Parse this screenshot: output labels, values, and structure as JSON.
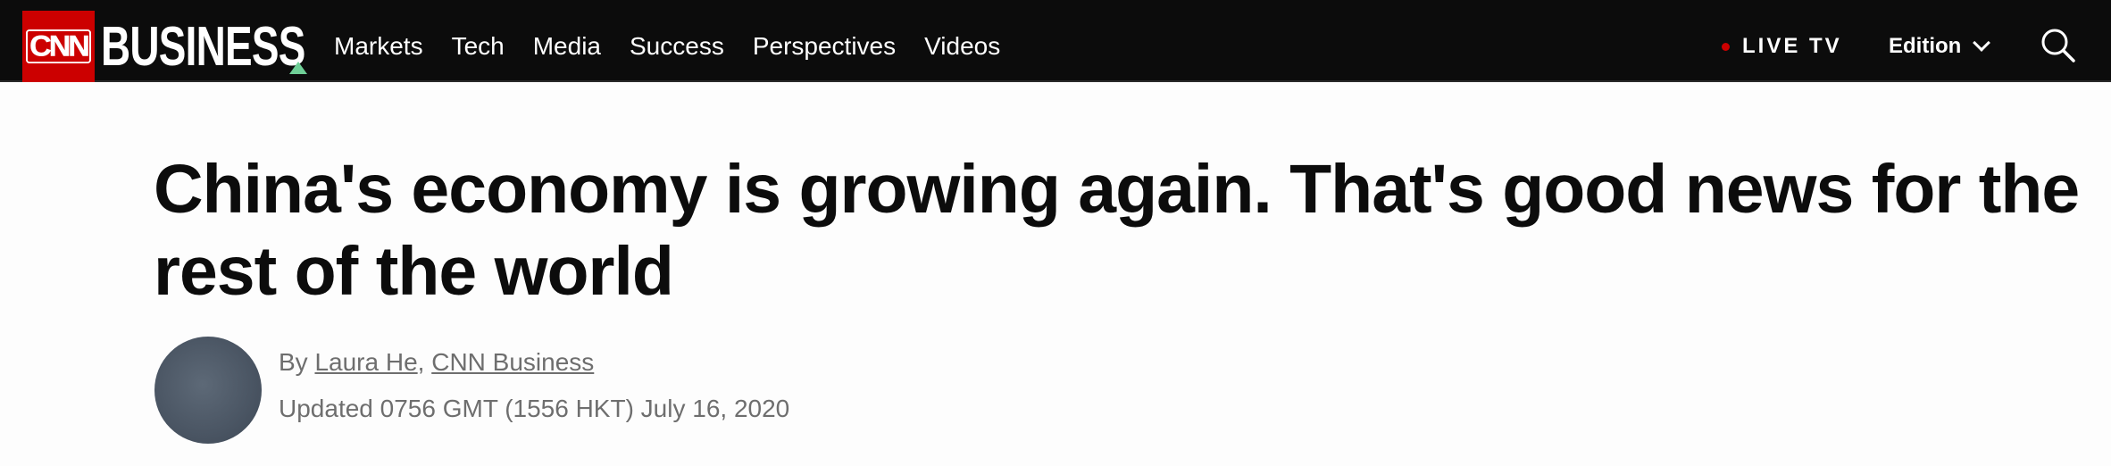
{
  "header": {
    "logo_cnn": "CNN",
    "logo_business": "BUSINESS",
    "nav": [
      "Markets",
      "Tech",
      "Media",
      "Success",
      "Perspectives",
      "Videos"
    ],
    "live_tv": "LIVE TV",
    "edition": "Edition"
  },
  "article": {
    "headline": "China's economy is growing again. That's good news for the rest of the world",
    "byline": {
      "prefix": "By",
      "author": "Laura He",
      "separator": ",",
      "source": "CNN Business"
    },
    "timestamp": "Updated 0756 GMT (1556 HKT) July 16, 2020"
  },
  "colors": {
    "nav_bg": "#0c0c0c",
    "brand_red": "#cc0000",
    "accent_green": "#6fcf97",
    "meta_gray": "#6e6e6e"
  }
}
